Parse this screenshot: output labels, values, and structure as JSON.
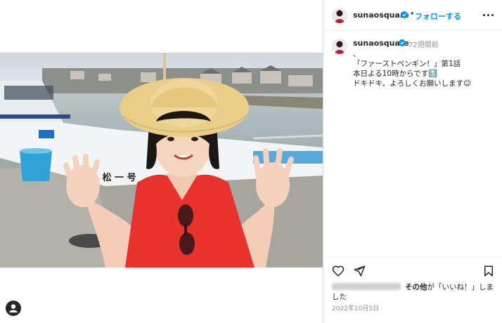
{
  "post": {
    "image_alt": "Woman in red top and straw hat at a harbor",
    "boat_name": "丸 松 一 号"
  },
  "header": {
    "username": "sunaosquare",
    "separator": "•",
    "follow_label": "フォローする",
    "more_icon": "more-horizontal-icon"
  },
  "caption": {
    "username": "sunaosquare",
    "time_ago": "72週間前",
    "lines": [
      "、",
      "「ファーストペンギン！」第1話",
      "本日よる10時からです🔝",
      "ドキドキ。よろしくお願いします☺︎"
    ]
  },
  "actions": {
    "like_icon": "heart-icon",
    "share_icon": "paper-plane-icon",
    "save_icon": "bookmark-icon"
  },
  "likes": {
    "others_label": "その他",
    "suffix": "が「いいね！」しました"
  },
  "date": "2022年10月5日",
  "colors": {
    "follow": "#0095f6",
    "verified": "#0095f6",
    "shirt": "#e8322d",
    "hat": "#e9cd88"
  }
}
